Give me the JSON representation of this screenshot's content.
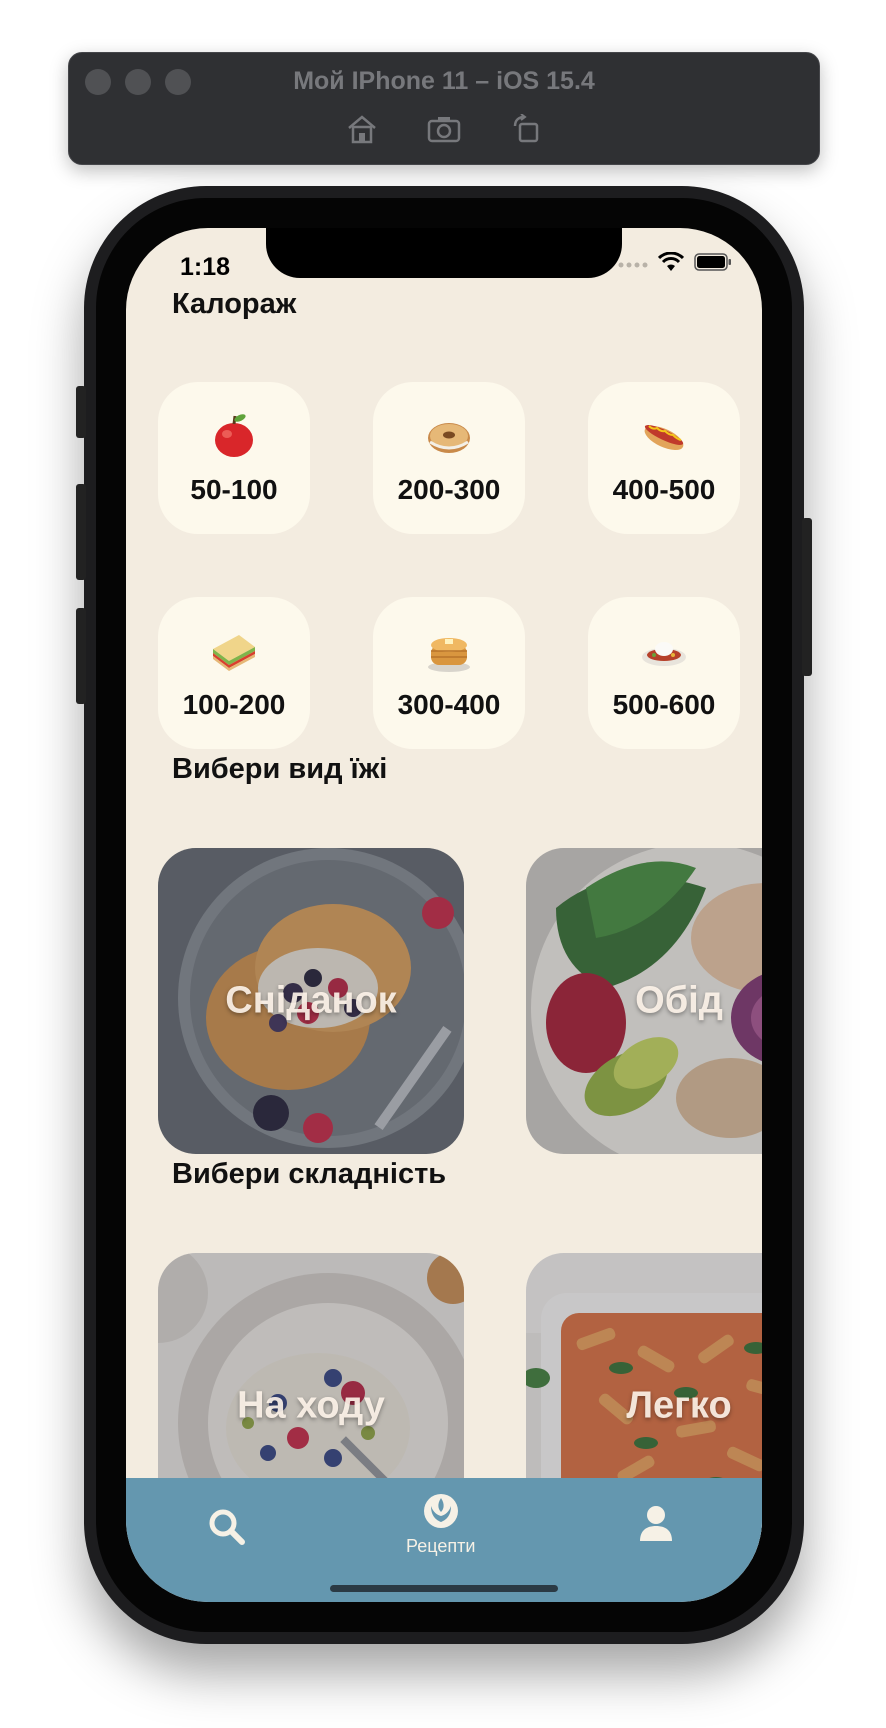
{
  "simulator": {
    "title": "Мой IPhone 11 – iOS 15.4",
    "tools": [
      "home-icon",
      "screenshot-icon",
      "rotate-icon"
    ]
  },
  "status_bar": {
    "time": "1:18",
    "icons": [
      "signal-icon",
      "wifi-icon",
      "battery-icon"
    ]
  },
  "calories": {
    "title": "Калораж",
    "items": [
      {
        "label": "50-100",
        "icon": "apple-icon"
      },
      {
        "label": "200-300",
        "icon": "bagel-icon"
      },
      {
        "label": "400-500",
        "icon": "hotdog-icon"
      },
      {
        "label": "100-200",
        "icon": "sandwich-icon"
      },
      {
        "label": "300-400",
        "icon": "pancakes-icon"
      },
      {
        "label": "500-600",
        "icon": "rice-bowl-icon"
      }
    ]
  },
  "meal_types": {
    "title": "Вибери вид їжі",
    "items": [
      {
        "label": "Сніданок",
        "image": "pancakes-photo"
      },
      {
        "label": "Обід",
        "image": "salad-photo"
      }
    ]
  },
  "difficulty": {
    "title": "Вибери складність",
    "items": [
      {
        "label": "На ходу",
        "image": "oatmeal-photo"
      },
      {
        "label": "Легко",
        "image": "pasta-photo"
      }
    ]
  },
  "tab_bar": {
    "tabs": [
      {
        "icon": "search-icon",
        "label": ""
      },
      {
        "icon": "rebel-icon",
        "label": "Рецепти"
      },
      {
        "icon": "profile-icon",
        "label": ""
      }
    ],
    "color": "#6497af"
  },
  "colors": {
    "background": "#f3ece0",
    "card": "#fdf9ec"
  }
}
